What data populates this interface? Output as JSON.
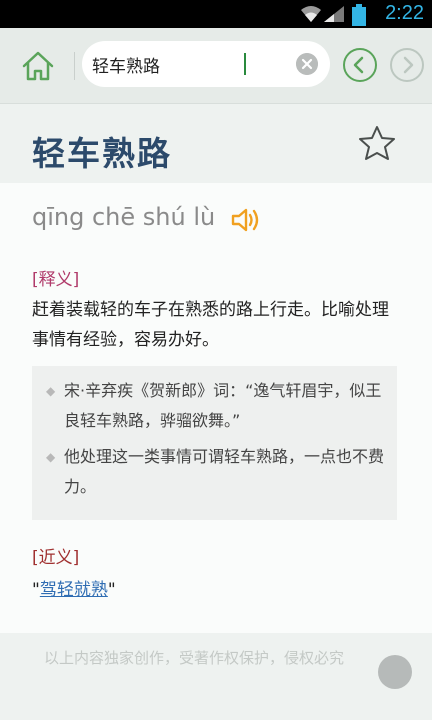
{
  "status_bar": {
    "time": "2:22"
  },
  "search": {
    "value": "轻车熟路"
  },
  "entry": {
    "title": "轻车熟路",
    "pinyin": "qīng chē shú lù",
    "definition_label": "[释义]",
    "definition": "赶着装载轻的车子在熟悉的路上行走。比喻处理事情有经验，容易办好。",
    "examples": [
      {
        "bullet": "◆",
        "text": "宋·辛弃疾《贺新郎》词：“逸气轩眉宇，似王良轻车熟路，骅骝欲舞。”"
      },
      {
        "bullet": "◆",
        "text": "他处理这一类事情可谓轻车熟路，一点也不费力。"
      }
    ],
    "synonym_label": "[近义]",
    "synonym_open_quote": "\"",
    "synonym": "驾轻就熟",
    "synonym_close_quote": "\""
  },
  "footer": {
    "note": "以上内容独家创作，受著作权保护，侵权必究"
  },
  "colors": {
    "accent_green": "#5aa45a",
    "title_blue": "#2c4a6b",
    "label_red": "#b03a6a",
    "link_blue": "#2f6db3"
  }
}
